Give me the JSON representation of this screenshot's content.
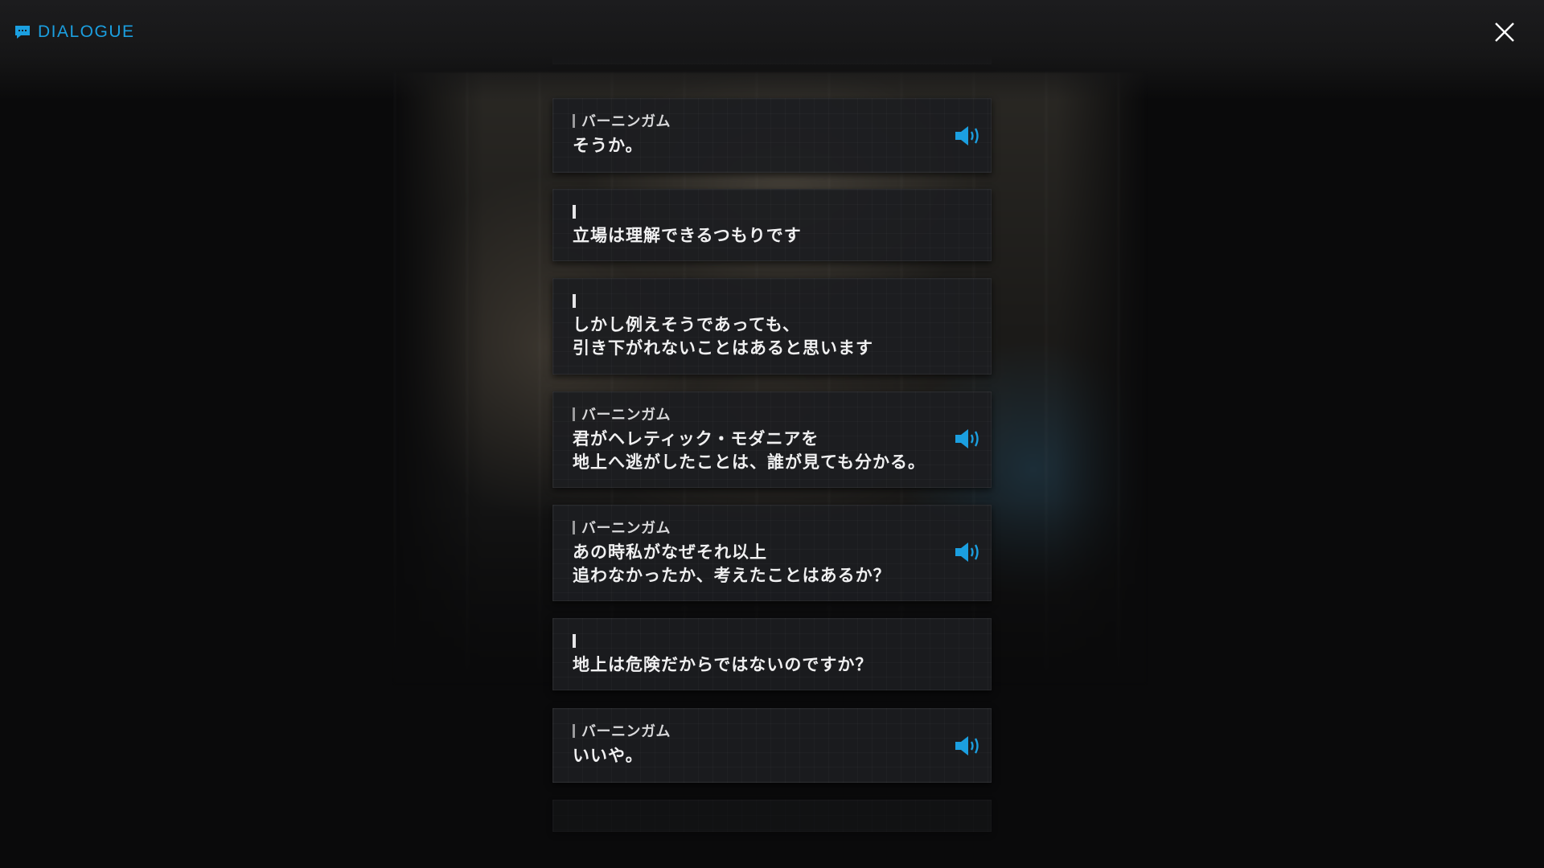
{
  "header": {
    "title": "DIALOGUE",
    "title_icon": "chat-bubble-icon",
    "close_icon": "close-icon",
    "accent_color": "#1b9fe0"
  },
  "entries": [
    {
      "speaker": "バーニンガム",
      "text": "そうか。",
      "has_voice": true
    },
    {
      "speaker": "",
      "text": "立場は理解できるつもりです",
      "has_voice": false
    },
    {
      "speaker": "",
      "text": "しかし例えそうであっても、\n引き下がれないことはあると思います",
      "has_voice": false
    },
    {
      "speaker": "バーニンガム",
      "text": "君がヘレティック・モダニアを\n地上へ逃がしたことは、誰が見ても分かる。",
      "has_voice": true
    },
    {
      "speaker": "バーニンガム",
      "text": "あの時私がなぜそれ以上\n追わなかったか、考えたことはあるか？",
      "has_voice": true
    },
    {
      "speaker": "",
      "text": "地上は危険だからではないのですか？",
      "has_voice": false
    },
    {
      "speaker": "バーニンガム",
      "text": "いいや。",
      "has_voice": true
    }
  ],
  "voice_icon": "speaker-volume-icon"
}
